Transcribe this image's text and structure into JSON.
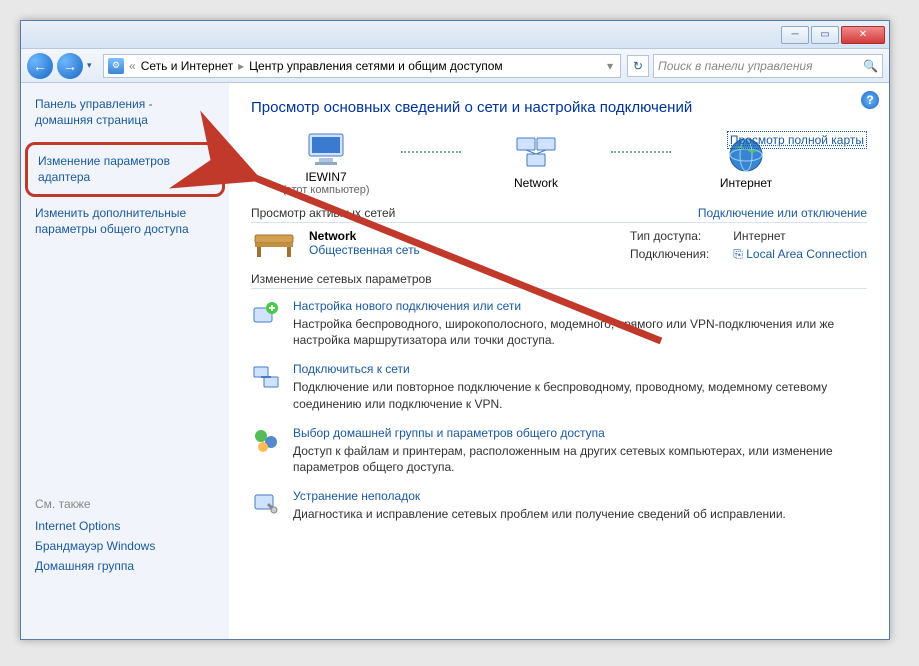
{
  "titlebar": {
    "minimize": "─",
    "maximize": "▭",
    "close": "✕"
  },
  "nav": {
    "back": "←",
    "forward": "→",
    "dropdown": "▾",
    "bc_root": "«",
    "bc_item1": "Сеть и Интернет",
    "bc_item2": "Центр управления сетями и общим доступом",
    "bc_drop": "▾",
    "refresh": "↻",
    "search_placeholder": "Поиск в панели управления",
    "search_icon": "🔍"
  },
  "sidebar": {
    "home_l1": "Панель управления -",
    "home_l2": "домашняя страница",
    "adapter_l1": "Изменение параметров",
    "adapter_l2": "адаптера",
    "sharing_l1": "Изменить дополнительные",
    "sharing_l2": "параметры общего доступа",
    "also_head": "См. также",
    "also1": "Internet Options",
    "also2": "Брандмауэр Windows",
    "also3": "Домашняя группа"
  },
  "main": {
    "heading": "Просмотр основных сведений о сети и настройка подключений",
    "map_link": "Просмотр полной карты",
    "node1_label": "IEWIN7",
    "node1_sub": "(этот компьютер)",
    "node2_label": "Network",
    "node3_label": "Интернет",
    "sec_active": "Просмотр активных сетей",
    "sec_active_right": "Подключение или отключение",
    "net_name": "Network",
    "net_type": "Общественная сеть",
    "net_access_lbl": "Тип доступа:",
    "net_access_val": "Интернет",
    "net_conn_lbl": "Подключения:",
    "net_conn_val": "Local Area Connection",
    "sec_change": "Изменение сетевых параметров",
    "task1_title": "Настройка нового подключения или сети",
    "task1_desc": "Настройка беспроводного, широкополосного, модемного, прямого или VPN-подключения или же настройка маршрутизатора или точки доступа.",
    "task2_title": "Подключиться к сети",
    "task2_desc": "Подключение или повторное подключение к беспроводному, проводному, модемному сетевому соединению или подключение к VPN.",
    "task3_title": "Выбор домашней группы и параметров общего доступа",
    "task3_desc": "Доступ к файлам и принтерам, расположенным на других сетевых компьютерах, или изменение параметров общего доступа.",
    "task4_title": "Устранение неполадок",
    "task4_desc": "Диагностика и исправление сетевых проблем или получение сведений об исправлении."
  },
  "help": "?"
}
